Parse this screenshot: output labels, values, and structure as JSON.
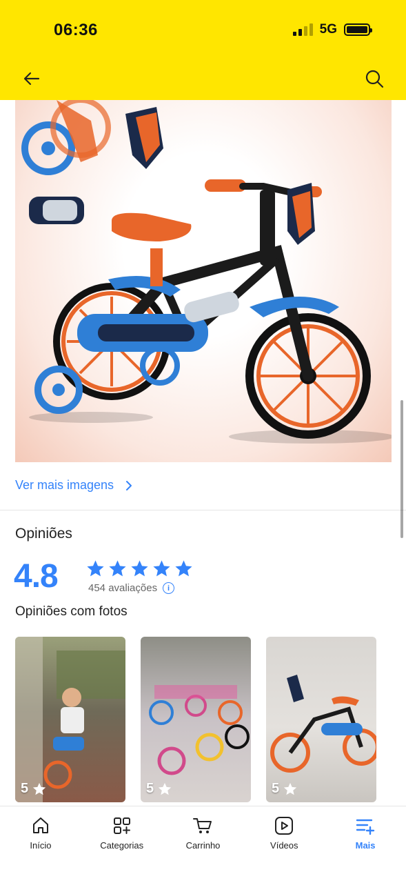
{
  "status_bar": {
    "time": "06:36",
    "network": "5G"
  },
  "header": {
    "back_icon": "arrow-left-icon",
    "search_icon": "search-icon",
    "bg_color": "#FFE600"
  },
  "gallery": {
    "see_more_label": "Ver mais imagens"
  },
  "reviews": {
    "section_title": "Opiniões",
    "rating": "4.8",
    "stars": 5,
    "count_label": "454 avaliações",
    "photos_title": "Opiniões com fotos",
    "photos": [
      {
        "rating": "5"
      },
      {
        "rating": "5"
      },
      {
        "rating": "5"
      }
    ],
    "accent_color": "#3483FA"
  },
  "bottom_nav": {
    "items": [
      {
        "label": "Início",
        "icon": "home-icon"
      },
      {
        "label": "Categorias",
        "icon": "categories-icon"
      },
      {
        "label": "Carrinho",
        "icon": "cart-icon"
      },
      {
        "label": "Vídeos",
        "icon": "video-icon"
      },
      {
        "label": "Mais",
        "icon": "more-icon",
        "active": true
      }
    ]
  }
}
